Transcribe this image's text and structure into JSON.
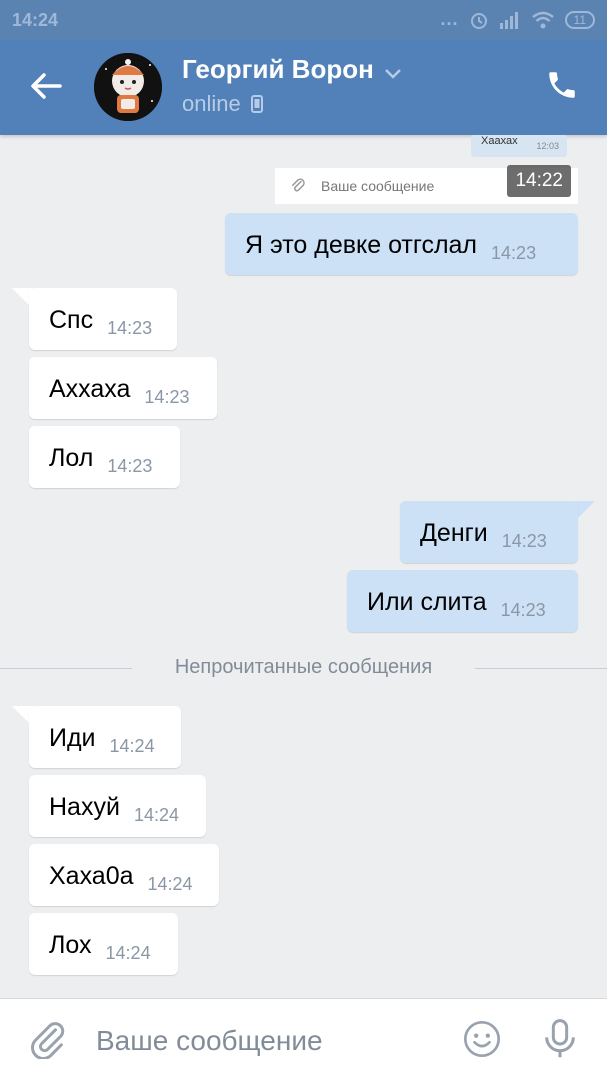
{
  "status_bar": {
    "time": "14:24",
    "battery": "11",
    "dots": "..."
  },
  "header": {
    "contact_name": "Георгий Ворон",
    "status": "online"
  },
  "embedded_screenshot": {
    "top_text": "Хаахах",
    "top_time": "12:03",
    "input_placeholder": "Ваше сообщение",
    "time_overlay": "14:22"
  },
  "messages_before": [
    {
      "direction": "out",
      "text": "Я это девке отгслал",
      "time": "14:23"
    },
    {
      "direction": "in",
      "text": "Спс",
      "time": "14:23"
    },
    {
      "direction": "in",
      "text": "Аххаха",
      "time": "14:23"
    },
    {
      "direction": "in",
      "text": "Лол",
      "time": "14:23"
    },
    {
      "direction": "out",
      "text": "Денги",
      "time": "14:23"
    },
    {
      "direction": "out",
      "text": "Или слита",
      "time": "14:23"
    }
  ],
  "unread_divider": "Непрочитанные сообщения",
  "messages_after": [
    {
      "direction": "in",
      "text": "Иди",
      "time": "14:24"
    },
    {
      "direction": "in",
      "text": "Нахуй",
      "time": "14:24"
    },
    {
      "direction": "in",
      "text": "Хаха0а",
      "time": "14:24"
    },
    {
      "direction": "in",
      "text": "Лох",
      "time": "14:24"
    }
  ],
  "input": {
    "placeholder": "Ваше сообщение",
    "value": ""
  },
  "icons": {
    "back": "arrow-left-icon",
    "chevron": "chevron-down-icon",
    "phone": "phone-icon",
    "device": "phone-device-icon",
    "attach": "paperclip-icon",
    "emoji": "smile-icon",
    "mic": "microphone-icon"
  },
  "colors": {
    "header": "#5181b8",
    "statusbar": "#5b83b2",
    "background": "#edeef0",
    "outgoing_bubble": "#cce0f6",
    "incoming_bubble": "#ffffff"
  }
}
